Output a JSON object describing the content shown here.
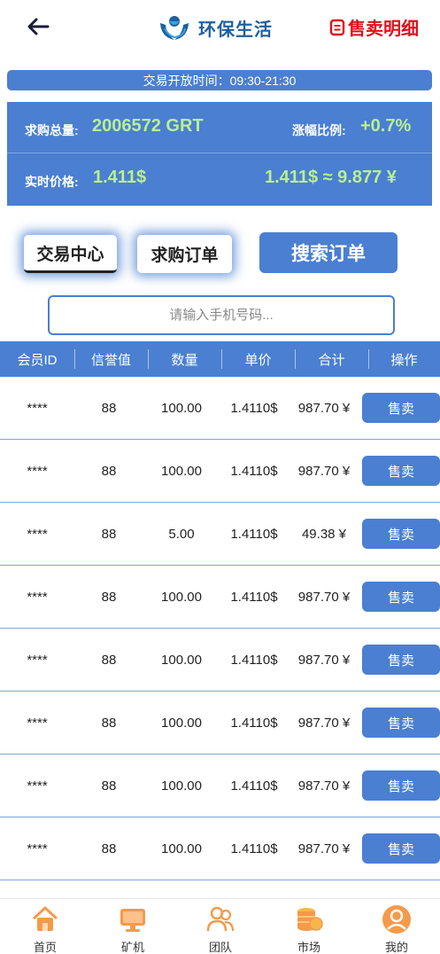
{
  "header": {
    "title": "环保生活",
    "detail_link": "售卖明细",
    "icons": {
      "back": "arrow-left-icon",
      "logo": "eco-hands-logo",
      "detail": "document-icon"
    }
  },
  "trading_hours": "交易开放时间：09:30-21:30",
  "stats": {
    "total_label": "求购总量:",
    "total_value": "2006572 GRT",
    "change_label": "涨幅比例:",
    "change_value": "+0.7%",
    "price_label": "实时价格:",
    "price_value": "1.411$",
    "conversion_value": "1.411$ ≈ 9.877 ¥",
    "value_color": "#b9f08f"
  },
  "tabs": {
    "trade_center": "交易中心",
    "buy_orders": "求购订单",
    "search_orders": "搜索订单"
  },
  "search": {
    "placeholder": "请输入手机号码..."
  },
  "table": {
    "headers": [
      "会员ID",
      "信誉值",
      "数量",
      "单价",
      "合计",
      "操作"
    ],
    "rows": [
      {
        "member_id": "****",
        "credit": "88",
        "quantity": "100.00",
        "unit_price": "1.4110$",
        "total": "987.70 ¥",
        "action": "售卖"
      },
      {
        "member_id": "****",
        "credit": "88",
        "quantity": "100.00",
        "unit_price": "1.4110$",
        "total": "987.70 ¥",
        "action": "售卖"
      },
      {
        "member_id": "****",
        "credit": "88",
        "quantity": "5.00",
        "unit_price": "1.4110$",
        "total": "49.38 ¥",
        "action": "售卖"
      },
      {
        "member_id": "****",
        "credit": "88",
        "quantity": "100.00",
        "unit_price": "1.4110$",
        "total": "987.70 ¥",
        "action": "售卖"
      },
      {
        "member_id": "****",
        "credit": "88",
        "quantity": "100.00",
        "unit_price": "1.4110$",
        "total": "987.70 ¥",
        "action": "售卖"
      },
      {
        "member_id": "****",
        "credit": "88",
        "quantity": "100.00",
        "unit_price": "1.4110$",
        "total": "987.70 ¥",
        "action": "售卖"
      },
      {
        "member_id": "****",
        "credit": "88",
        "quantity": "100.00",
        "unit_price": "1.4110$",
        "total": "987.70 ¥",
        "action": "售卖"
      },
      {
        "member_id": "****",
        "credit": "88",
        "quantity": "100.00",
        "unit_price": "1.4110$",
        "total": "987.70 ¥",
        "action": "售卖"
      }
    ]
  },
  "nav": {
    "items": [
      {
        "label": "首页",
        "icon": "home-icon"
      },
      {
        "label": "矿机",
        "icon": "monitor-icon"
      },
      {
        "label": "团队",
        "icon": "team-icon"
      },
      {
        "label": "市场",
        "icon": "coins-icon"
      },
      {
        "label": "我的",
        "icon": "profile-icon"
      }
    ]
  },
  "colors": {
    "accent": "#4a7fd1",
    "brand": "#1f5f9e",
    "detail": "#e0101a",
    "nav_icon": "#f59a4a"
  }
}
